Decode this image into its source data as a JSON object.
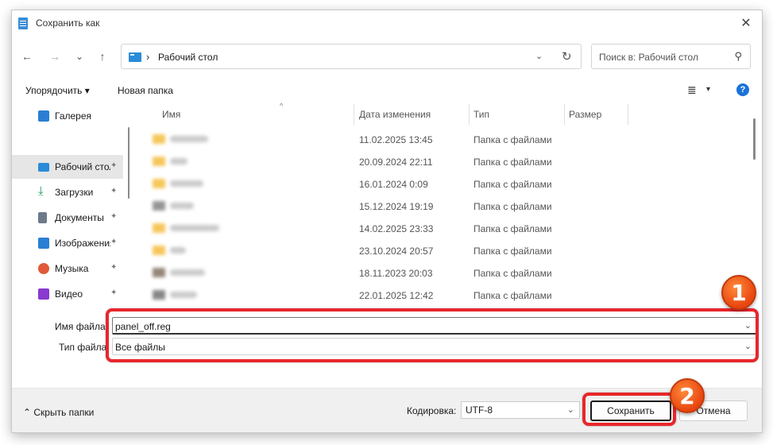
{
  "window": {
    "title": "Сохранить как"
  },
  "nav": {
    "back": "←",
    "forward": "→",
    "recent": "⌄",
    "up": "↑",
    "address_sep": "›",
    "path": "Рабочий стол",
    "dropdown": "⌄",
    "refresh": "↻",
    "search_placeholder": "Поиск в: Рабочий стол"
  },
  "toolbar": {
    "organize": "Упорядочить ▾",
    "new_folder": "Новая папка",
    "view": "≣",
    "view_dd": "▾",
    "help": "?"
  },
  "sidebar": {
    "items": [
      {
        "label": "Галерея",
        "pinned": false,
        "selected": false,
        "color": "#2a7fd4"
      },
      {
        "label": "Рабочий стол",
        "pinned": true,
        "selected": true,
        "color": "#2a8bd8"
      },
      {
        "label": "Загрузки",
        "pinned": true,
        "selected": false,
        "color": "#1e9a5a"
      },
      {
        "label": "Документы",
        "pinned": true,
        "selected": false,
        "color": "#6c7a8a"
      },
      {
        "label": "Изображения",
        "pinned": true,
        "selected": false,
        "color": "#2a7fd4"
      },
      {
        "label": "Музыка",
        "pinned": true,
        "selected": false,
        "color": "#e05a3a"
      },
      {
        "label": "Видео",
        "pinned": true,
        "selected": false,
        "color": "#8a3ad0"
      }
    ],
    "pin_glyph": "📌"
  },
  "columns": {
    "name": "Имя",
    "date": "Дата изменения",
    "type": "Тип",
    "size": "Размер",
    "sort": "^"
  },
  "files": [
    {
      "date": "11.02.2025 13:45",
      "type": "Папка с файлами"
    },
    {
      "date": "20.09.2024 22:11",
      "type": "Папка с файлами"
    },
    {
      "date": "16.01.2024 0:09",
      "type": "Папка с файлами"
    },
    {
      "date": "15.12.2024 19:19",
      "type": "Папка с файлами"
    },
    {
      "date": "14.02.2025 23:33",
      "type": "Папка с файлами"
    },
    {
      "date": "23.10.2024 20:57",
      "type": "Папка с файлами"
    },
    {
      "date": "18.11.2023 20:03",
      "type": "Папка с файлами"
    },
    {
      "date": "22.01.2025 12:42",
      "type": "Папка с файлами"
    }
  ],
  "form": {
    "filename_label": "Имя файла:",
    "filename_value": "panel_off.reg",
    "filetype_label": "Тип файла:",
    "filetype_value": "Все файлы",
    "caret": "⌄"
  },
  "footer": {
    "hide_folders": "⌃  Скрыть папки",
    "encoding_label": "Кодировка:",
    "encoding_value": "UTF-8",
    "save": "Сохранить",
    "cancel": "Отмена"
  },
  "annotations": {
    "badge1": "1",
    "badge2": "2",
    "highlight_color": "#e8262a"
  }
}
